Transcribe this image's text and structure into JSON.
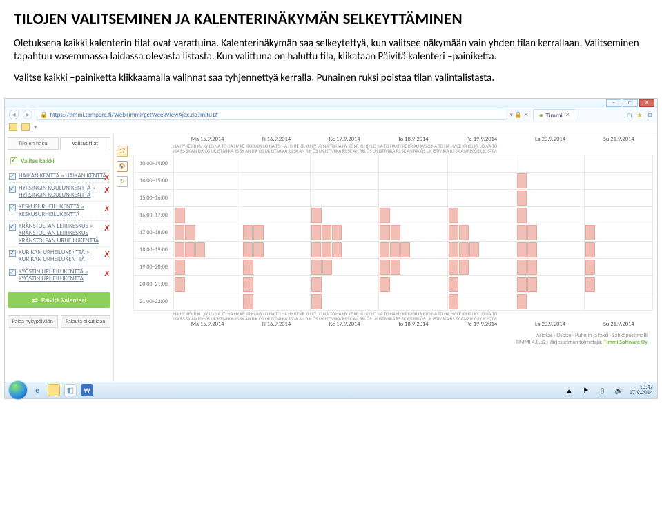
{
  "title": "TILOJEN VALITSEMINEN JA KALENTERINÄKYMÄN SELKEYTTÄMINEN",
  "para1": "Oletuksena kaikki kalenterin tilat ovat varattuina. Kalenterinäkymän saa selkeytettyä, kun valitsee näkymään vain yhden tilan kerrallaan. Valitseminen tapahtuu vasemmassa laidassa olevasta listasta. Kun valittuna on haluttu tila, klikataan Päivitä kalenteri –painiketta.",
  "para2": "Valitse kaikki –painiketta klikkaamalla valinnat saa tyhjennettyä kerralla. Punainen ruksi poistaa tilan valintalistasta.",
  "browser": {
    "url": "https://timmi.tampere.fi/WebTimmi/getWeekViewAjax.do?mitu1#",
    "tab_title": "Timmi"
  },
  "sidebar": {
    "tab1": "Tilojen haku",
    "tab2": "Valitut tilat",
    "select_all": "Valitse kaikki",
    "rooms": [
      "HAIKAN KENTTÄ » HAIKAN KENTTÄ",
      "HYRSINGIN KOULUN KENTTÄ » HYRSINGIN KOULUN KENTTÄ",
      "KESKUSURHEILUKENTTÄ » KESKUSURHEILUKENTTÄ",
      "KRÄNSTOLPAN LEIRIKESKUS » KRÄNSTOLPAN LEIRIKESKUS KRÄNSTOLPAN URHEILUKENTTÄ",
      "KURIKAN URHEILUKENTTÄ » KURIKAN URHEILUKENTTÄ",
      "KYÖSTIN URHEILUKENTTÄ » KYÖSTIN URHEILUKENTTÄ"
    ],
    "update_btn": "Päivitä kalenteri",
    "btn_today": "Palaa nykypäivään",
    "btn_reset": "Palauta alkutilaan"
  },
  "calendar": {
    "icon_day": "17",
    "days": [
      {
        "t": "Ma 15.9.2014"
      },
      {
        "t": "Ti 16.9.2014"
      },
      {
        "t": "Ke 17.9.2014"
      },
      {
        "t": "To 18.9.2014"
      },
      {
        "t": "Pe 19.9.2014"
      },
      {
        "t": "La 20.9.2014"
      },
      {
        "t": "Su 21.9.2014"
      }
    ],
    "subhdr1": "HA HY KE KR KU KY LO NA TO HA HY KE KR KU KY LO NA TO HA HY KE KR KU KY LO NA TO HA HY KE KR KU KY LO NA TO HA HY KE KR KU KY LO NA TO HA HY KE KR KU KY LO NA TO",
    "subhdr2": "IKA RS SK AN RIK ÖS UK ISTIVIIKA RS SK AN RIK ÖS UK ISTIVIIKA RS SK AN RIK ÖS UK ISTIVIIKA RS SK AN RIK ÖS UK ISTIVIIKA RS SK AN RIK ÖS UK ISTIVIIKA RS SK AN RIK ÖS UK ISTIVI",
    "times": [
      "10:00–14:00",
      "14:00–15:00",
      "15:00–16:00",
      "16:00–17:00",
      "17:00–18:00",
      "18:00–19:00",
      "19:00–20:00",
      "20:00–21:00",
      "21:00–22:00"
    ],
    "footer_days": [
      {
        "t": "Ma 15.9.2014"
      },
      {
        "t": "Ti 16.9.2014"
      },
      {
        "t": "Ke 17.9.2014"
      },
      {
        "t": "To 18.9.2014"
      },
      {
        "t": "Pe 19.9.2014"
      },
      {
        "t": "La 20.9.2014"
      },
      {
        "t": "Su 21.9.2014"
      }
    ]
  },
  "footer_note": {
    "l1": "Asiakas · Osoite · Puhelin ja faksi · Sähköpostimalli",
    "l2_a": "TIMMI 4.0.52 · Järjestelmän toimittaja: ",
    "l2_b": "Timmi Software Oy"
  },
  "taskbar": {
    "time": "13:47",
    "date": "17.9.2014"
  }
}
